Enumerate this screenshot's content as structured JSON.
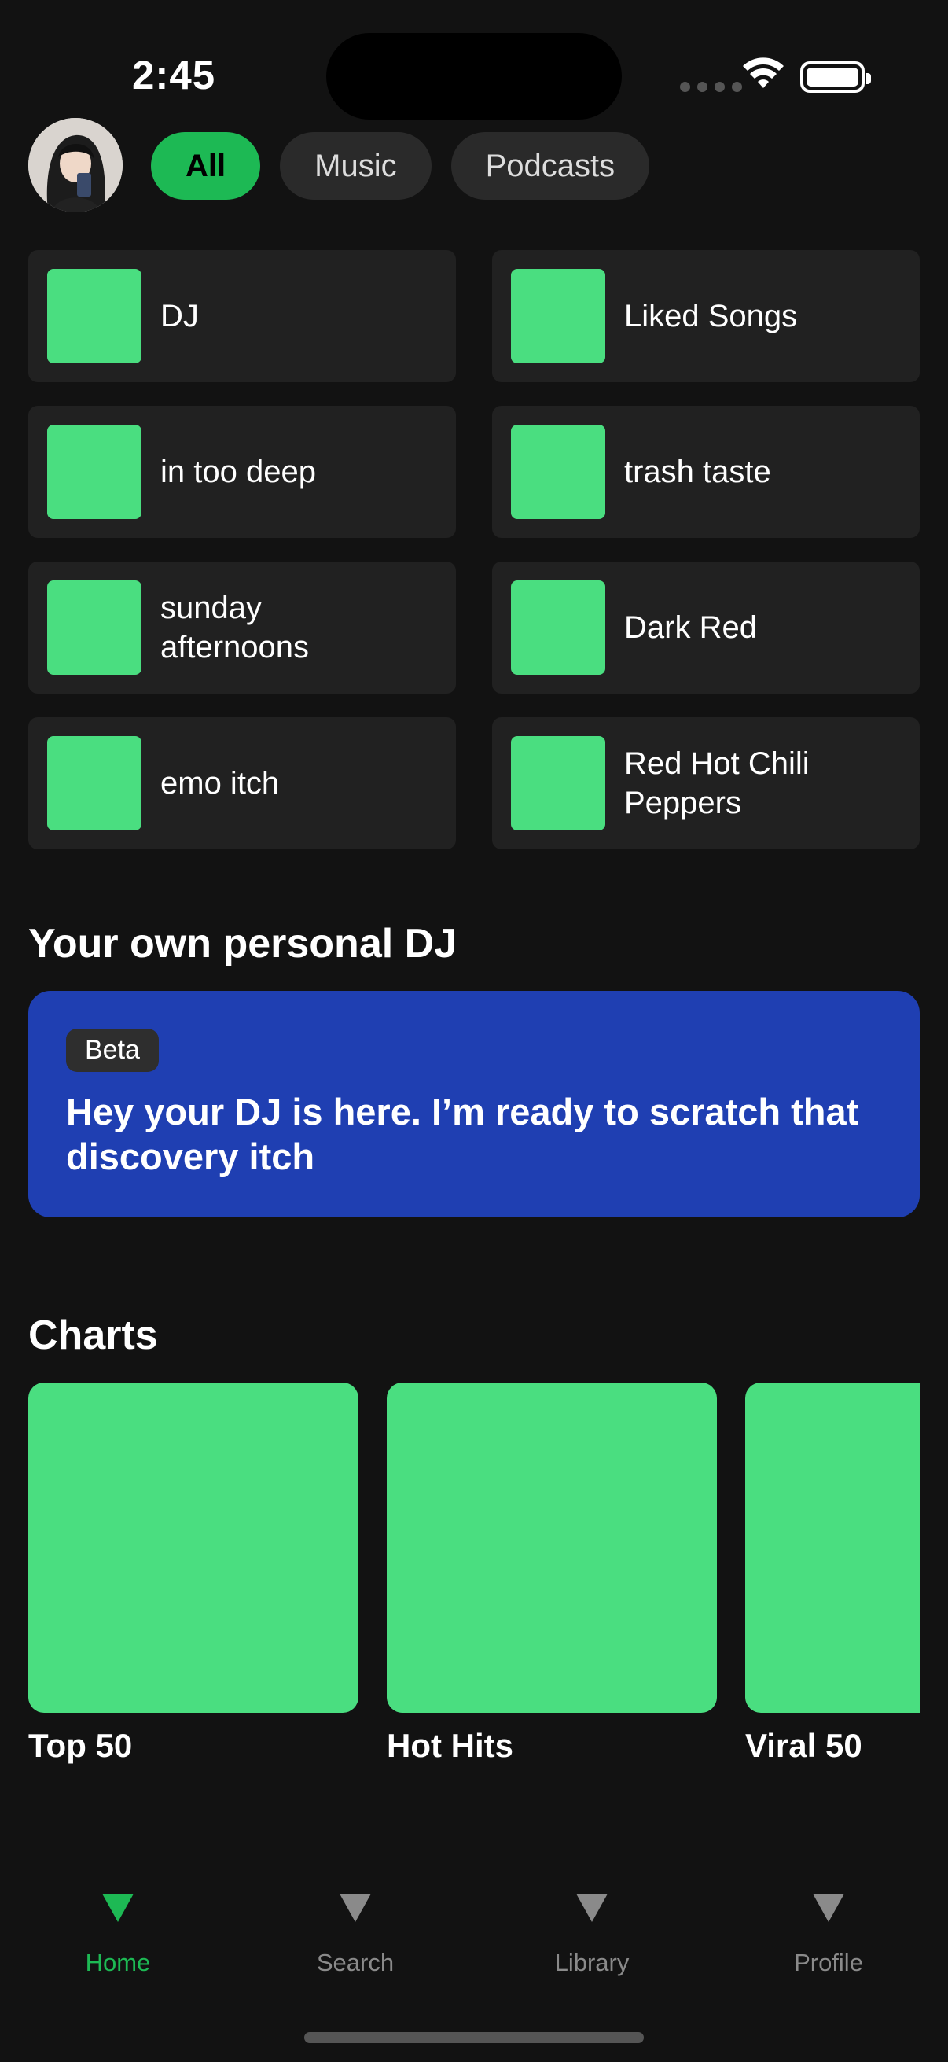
{
  "status_bar": {
    "time": "2:45"
  },
  "filters": [
    {
      "label": "All",
      "active": true
    },
    {
      "label": "Music",
      "active": false
    },
    {
      "label": "Podcasts",
      "active": false
    }
  ],
  "shortcuts": [
    {
      "label": "DJ"
    },
    {
      "label": "Liked Songs"
    },
    {
      "label": "in too deep"
    },
    {
      "label": "trash taste"
    },
    {
      "label": "sunday afternoons"
    },
    {
      "label": "Dark Red"
    },
    {
      "label": "emo itch"
    },
    {
      "label": "Red Hot Chili Peppers"
    }
  ],
  "dj_section": {
    "title": "Your own personal DJ",
    "badge": "Beta",
    "message": "Hey your DJ is here. I’m ready to scratch that discovery itch"
  },
  "charts_section": {
    "title": "Charts",
    "items": [
      {
        "name": "Top 50"
      },
      {
        "name": "Hot Hits"
      },
      {
        "name": "Viral 50"
      }
    ]
  },
  "nav": [
    {
      "label": "Home",
      "active": true
    },
    {
      "label": "Search",
      "active": false
    },
    {
      "label": "Library",
      "active": false
    },
    {
      "label": "Profile",
      "active": false
    }
  ],
  "colors": {
    "background": "#121212",
    "accent": "#1db954",
    "tile": "#4ade80",
    "dj_card": "#1f3fb2"
  }
}
